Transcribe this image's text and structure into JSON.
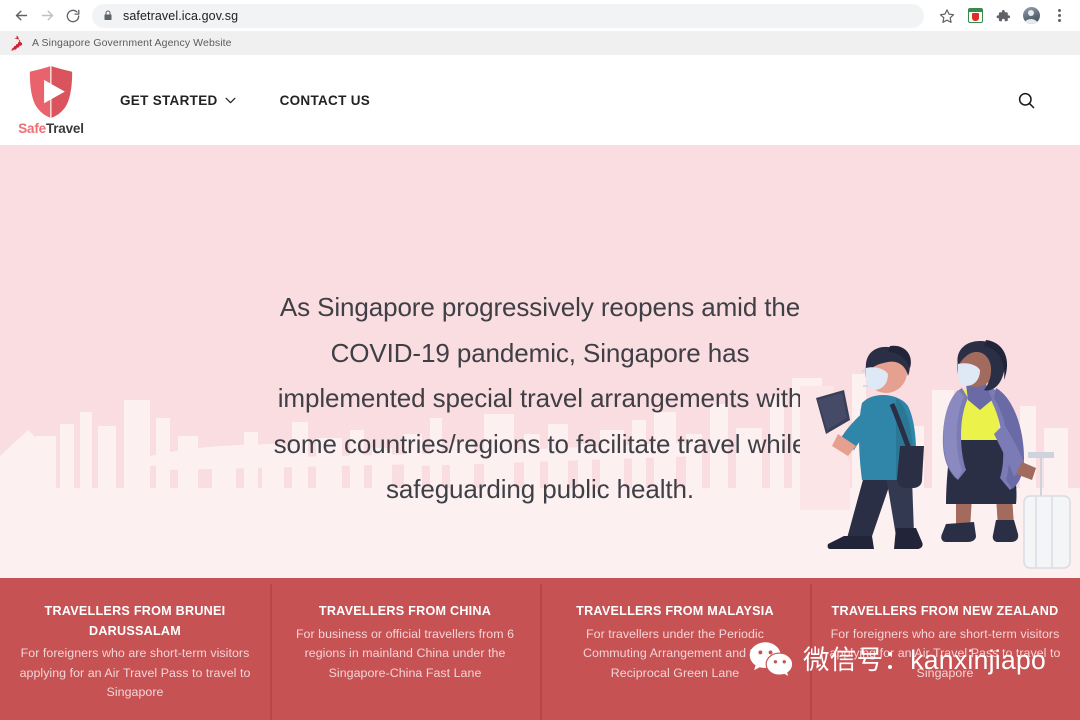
{
  "browser": {
    "back_label": "Back",
    "forward_label": "Forward",
    "reload_label": "Reload",
    "url": "safetravel.ica.gov.sg",
    "lock_icon": "lock-icon",
    "bookmark_icon": "star-icon",
    "extension_icon": "extension-badge-icon",
    "extensions_icon": "puzzle-piece-icon",
    "profile_icon": "avatar-icon",
    "menu_icon": "kebab-menu-icon"
  },
  "gov_banner": {
    "icon": "singapore-lion-icon",
    "text": "A Singapore Government Agency Website"
  },
  "header": {
    "logo": {
      "mark": "safetravel-shield-icon",
      "word_1": "Safe",
      "word_2": "Travel"
    },
    "nav": [
      {
        "label": "GET STARTED",
        "has_dropdown": true,
        "icon": "chevron-down-icon"
      },
      {
        "label": "CONTACT US",
        "has_dropdown": false
      }
    ],
    "search_icon": "search-icon"
  },
  "hero": {
    "paragraph": "As Singapore progressively reopens amid the COVID-19 pandemic, Singapore has implemented special travel arrangements with some countries/regions to facilitate travel while safeguarding public health.",
    "background_color": "#F9DDE0",
    "skyline_color": "#FDF0F1",
    "illustration": "two-masked-travellers-illustration"
  },
  "cards": {
    "background_color": "#C75254",
    "items": [
      {
        "title": "TRAVELLERS FROM BRUNEI DARUSSALAM",
        "description": "For foreigners who are short-term visitors applying for an Air Travel Pass to travel to Singapore"
      },
      {
        "title": "TRAVELLERS FROM CHINA",
        "description": "For business or official travellers from 6 regions in mainland China under the Singapore-China Fast Lane"
      },
      {
        "title": "TRAVELLERS FROM MALAYSIA",
        "description": "For travellers under the Periodic Commuting Arrangement and the Reciprocal Green Lane"
      },
      {
        "title": "TRAVELLERS FROM NEW ZEALAND",
        "description": "For foreigners who are short-term visitors applying for an Air Travel Pass to travel to Singapore"
      }
    ]
  },
  "watermark": {
    "icon": "wechat-logo-icon",
    "text": "微信号：kanxinjiapo"
  }
}
